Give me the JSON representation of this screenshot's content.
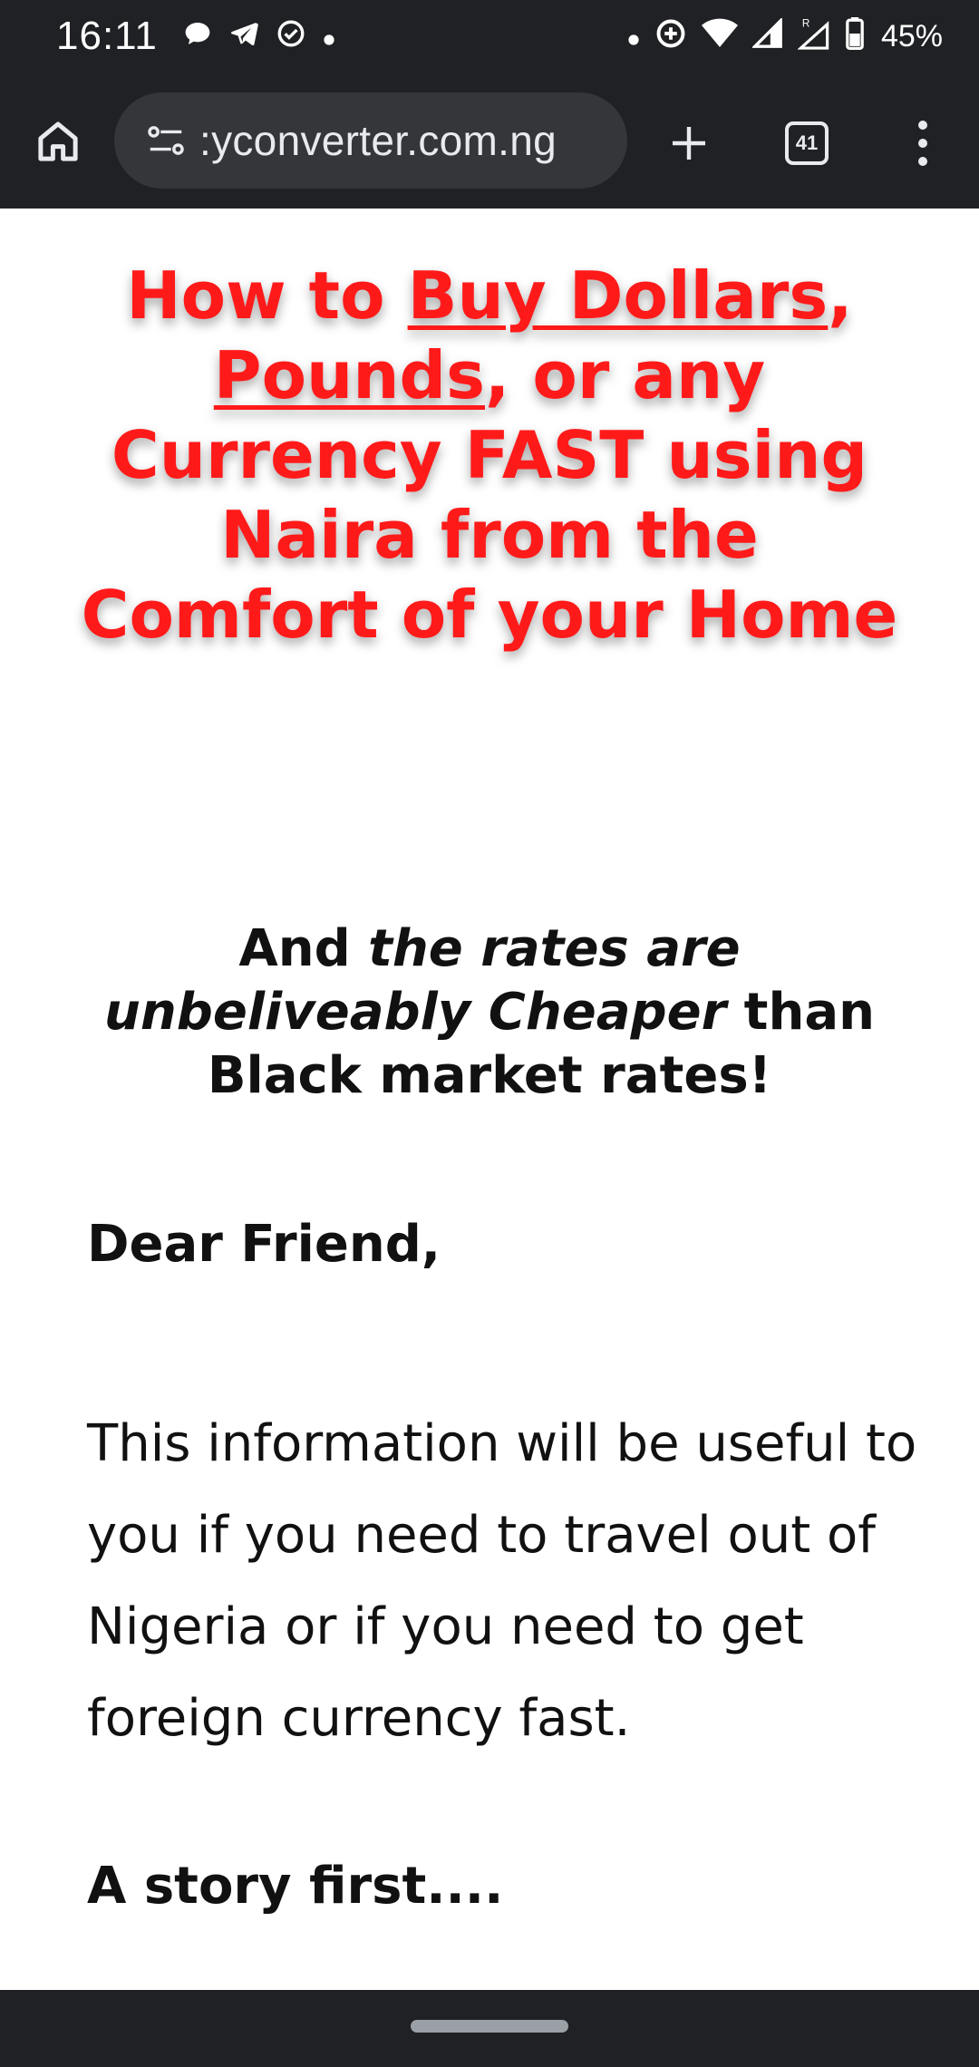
{
  "status_bar": {
    "time": "16:11",
    "left_icons": [
      "chat-bubble-icon",
      "telegram-icon",
      "check-circle-icon",
      "dot-icon"
    ],
    "right_icons": [
      "dot-icon",
      "data-saver-icon",
      "wifi-icon",
      "signal-icon",
      "signal-roaming-icon",
      "battery-icon"
    ],
    "battery": "45%"
  },
  "toolbar": {
    "url": ":yconverter.com.ng",
    "tab_count": "41"
  },
  "page": {
    "headline_part1": "How to ",
    "headline_link1": "Buy Dollars",
    "headline_part2": ", ",
    "headline_link2": "Pounds",
    "headline_part3": ", or any Currency FAST using Naira from the Comfort of your Home",
    "subhead_part1": "And ",
    "subhead_italic": "the rates are unbeliveably Cheaper",
    "subhead_part2": " than Black market rates!",
    "salutation": "Dear Friend,",
    "paragraph": "This information will be useful to you if you need to travel out of Nigeria or if you need to get foreign currency fast.",
    "story_heading": "A story first...."
  },
  "colors": {
    "headline": "#ff1a1a",
    "browser_chrome": "#202124",
    "address_bar": "#35363a"
  }
}
